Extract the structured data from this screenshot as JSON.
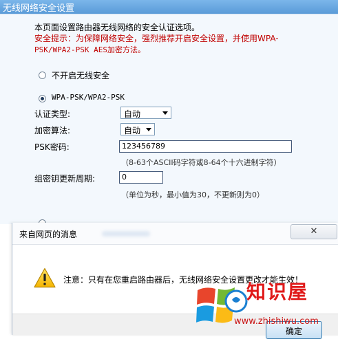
{
  "page": {
    "header_title": "无线网络安全设置",
    "description": "本页面设置路由器无线网络的安全认证选项。",
    "warning_line1": "安全提示：为保障网络安全，强烈推荐开启安全设置，并使用WPA-",
    "warning_line2": "PSK/WPA2-PSK AES加密方法。",
    "options": [
      {
        "label": "不开启无线安全",
        "checked": false
      },
      {
        "label": "WPA-PSK/WPA2-PSK",
        "checked": true
      }
    ],
    "auth_type": {
      "label": "认证类型:",
      "value": "自动"
    },
    "encryption": {
      "label": "加密算法:",
      "value": "自动"
    },
    "psk": {
      "label": "PSK密码:",
      "value": "123456789",
      "hint": "（8-63个ASCII码字符或8-64个十六进制字符）"
    },
    "group_key": {
      "label": "组密钥更新周期:",
      "value": "0",
      "hint": "（单位为秒，最小值为30，不更新则为0）"
    }
  },
  "dialog": {
    "title": "来自网页的消息",
    "message": "注意：只有在您重启路由器后，无线网络安全设置更改才能生效！",
    "close_icon": "close-icon",
    "ok_label": "确定"
  },
  "watermark": {
    "name": "知识屋",
    "url": "www.zhishiwu.com"
  },
  "colors": {
    "header_bg": "#5a9bd8",
    "warning_text": "#c00000",
    "watermark_red": "#e01919"
  }
}
